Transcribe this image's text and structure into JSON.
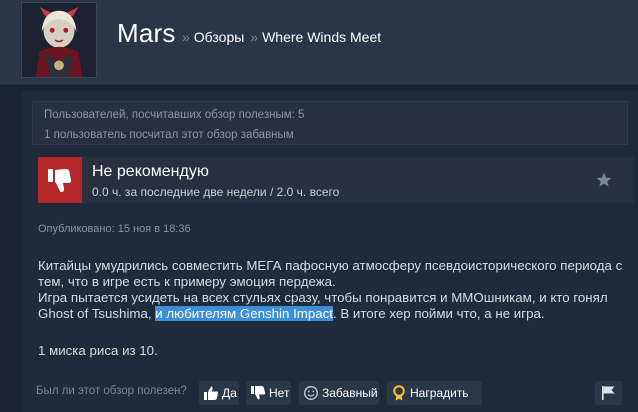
{
  "header": {
    "user_name": "Mars",
    "breadcrumbs": [
      {
        "sep": "»",
        "label": "Обзоры"
      },
      {
        "sep": "»",
        "label": "Where Winds Meet"
      }
    ],
    "avatar_icon": "user-avatar"
  },
  "review": {
    "helpful_count_text": "Пользователей, посчитавших обзор полезным: 5",
    "funny_count_text": "1 пользователь посчитал этот обзор забавным",
    "verdict": "Не рекомендую",
    "hours": "0.0 ч. за последние две недели / 2.0 ч. всего",
    "posted": "Опубликовано: 15 ноя в 18:36",
    "body": {
      "line1": "Китайцы умудрились совместить МЕГА пафосную атмосферу псевдоисторического периода с",
      "line2": "тем, что в игре есть к примеру эмоция пердежа.",
      "line3": "Игра пытается усидеть на всех стульях сразу, чтобы понравится и ММОшникам, и кто гонял",
      "line4_pre": "Ghost of Tsushima, ",
      "line4_highlight": "и любителям Genshin Impact",
      "line4_post": ". В итоге хер пойми что, а не игра."
    },
    "rating_line": "1 миска риса из 10."
  },
  "footer": {
    "question": "Был ли этот обзор полезен?",
    "yes_label": "Да",
    "no_label": "Нет",
    "funny_label": "Забавный",
    "award_label": "Наградить"
  },
  "colors": {
    "background": "#1b2434",
    "header": "#2a3547",
    "thumbs_down": "#b4272a",
    "highlight": "#3b8fd8"
  }
}
